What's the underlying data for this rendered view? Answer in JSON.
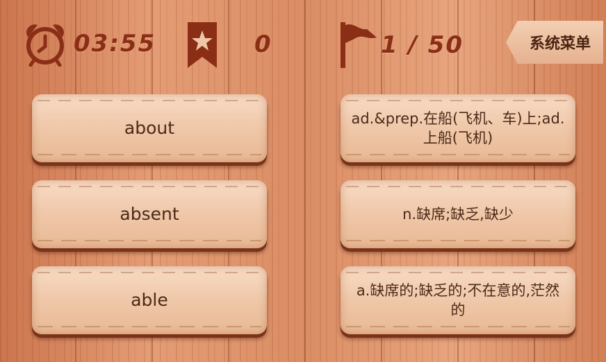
{
  "hud": {
    "timer": "03:55",
    "stars": "0",
    "progress": "1 / 50",
    "menu_label": "系统菜单"
  },
  "words": [
    "about",
    "absent",
    "able"
  ],
  "definitions": [
    "ad.&prep.在船(飞机、车)上;ad.上船(飞机)",
    "n.缺席;缺乏,缺少",
    "a.缺席的;缺乏的;不在意的,茫然的"
  ],
  "colors": {
    "accent": "#8a2e16",
    "card_text": "#4b2a18"
  },
  "icons": [
    "alarm-clock-icon",
    "star-bookmark-icon",
    "flag-icon"
  ]
}
